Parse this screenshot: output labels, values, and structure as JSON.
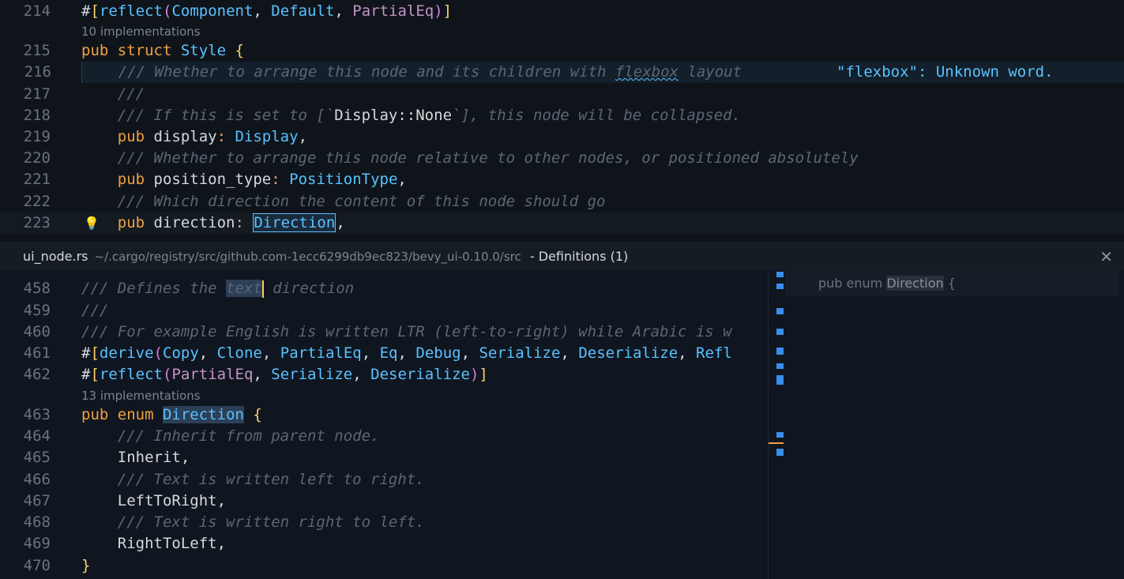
{
  "editor": {
    "lines": [
      {
        "num": "214",
        "tokens": [
          [
            "punc",
            "#"
          ],
          [
            "br1",
            "["
          ],
          [
            "fn",
            "reflect"
          ],
          [
            "br2",
            "("
          ],
          [
            "ty",
            "Component"
          ],
          [
            "punc",
            ", "
          ],
          [
            "ty",
            "Default"
          ],
          [
            "punc",
            ", "
          ],
          [
            "gen",
            "PartialEq"
          ],
          [
            "br2",
            ")"
          ],
          [
            "br1",
            "]"
          ]
        ]
      },
      {
        "num": "215",
        "tokens": [
          [
            "kw",
            "pub "
          ],
          [
            "kw",
            "struct "
          ],
          [
            "ty",
            "Style "
          ],
          [
            "br1",
            "{"
          ]
        ]
      },
      {
        "num": "216",
        "tokens": [
          [
            "cm",
            "    /// Whether to arrange this node and its children with "
          ],
          [
            "cm squiggle",
            "flexbox"
          ],
          [
            "cm",
            " layout"
          ]
        ]
      },
      {
        "num": "217",
        "tokens": [
          [
            "cm",
            "    ///"
          ]
        ]
      },
      {
        "num": "218",
        "tokens": [
          [
            "cm",
            "    /// If this is set to [`"
          ],
          [
            "punc",
            "Display::None"
          ],
          [
            "cm",
            "`], this node will be collapsed."
          ]
        ]
      },
      {
        "num": "219",
        "tokens": [
          [
            "kw",
            "    pub "
          ],
          [
            "punc",
            "display"
          ],
          [
            "op",
            ": "
          ],
          [
            "ty",
            "Display"
          ],
          [
            "punc",
            ","
          ]
        ]
      },
      {
        "num": "220",
        "tokens": [
          [
            "cm",
            "    /// Whether to arrange this node relative to other nodes, or positioned absolutely"
          ]
        ]
      },
      {
        "num": "221",
        "tokens": [
          [
            "kw",
            "    pub "
          ],
          [
            "punc",
            "position_type"
          ],
          [
            "op",
            ": "
          ],
          [
            "ty",
            "PositionType"
          ],
          [
            "punc",
            ","
          ]
        ]
      },
      {
        "num": "222",
        "tokens": [
          [
            "cm",
            "    /// Which direction the content of this node should go"
          ]
        ]
      },
      {
        "num": "223",
        "tokens": [
          [
            "kw",
            "    pub "
          ],
          [
            "punc",
            "direction"
          ],
          [
            "op",
            ": "
          ],
          [
            "ty boxed",
            "Direction"
          ],
          [
            "punc",
            ","
          ]
        ]
      }
    ],
    "lens_top": "10 implementations",
    "diagnostic": "\"flexbox\": Unknown word."
  },
  "peek": {
    "file": "ui_node.rs",
    "path": "~/.cargo/registry/src/github.com-1ecc6299db9ec823/bevy_ui-0.10.0/src",
    "title": "- Definitions (1)",
    "close_icon": "close-icon",
    "ref_prefix": "pub enum ",
    "ref_name": "Direction",
    "ref_suffix": " {",
    "lens": "13 implementations",
    "lines": [
      {
        "num": "458",
        "tokens": [
          [
            "cm",
            "/// Defines the "
          ],
          [
            "cm sel",
            "text"
          ],
          [
            "cursor",
            ""
          ],
          [
            "cm",
            " direction"
          ]
        ]
      },
      {
        "num": "459",
        "tokens": [
          [
            "cm",
            "///"
          ]
        ]
      },
      {
        "num": "460",
        "tokens": [
          [
            "cm",
            "/// For example English is written LTR (left-to-right) while Arabic is w"
          ]
        ]
      },
      {
        "num": "461",
        "tokens": [
          [
            "punc",
            "#"
          ],
          [
            "br1",
            "["
          ],
          [
            "fn",
            "derive"
          ],
          [
            "br2",
            "("
          ],
          [
            "ty",
            "Copy"
          ],
          [
            "punc",
            ", "
          ],
          [
            "ty",
            "Clone"
          ],
          [
            "punc",
            ", "
          ],
          [
            "ty",
            "PartialEq"
          ],
          [
            "punc",
            ", "
          ],
          [
            "ty",
            "Eq"
          ],
          [
            "punc",
            ", "
          ],
          [
            "ty",
            "Debug"
          ],
          [
            "punc",
            ", "
          ],
          [
            "ty",
            "Serialize"
          ],
          [
            "punc",
            ", "
          ],
          [
            "ty",
            "Deserialize"
          ],
          [
            "punc",
            ", "
          ],
          [
            "ty",
            "Refl"
          ]
        ]
      },
      {
        "num": "462",
        "tokens": [
          [
            "punc",
            "#"
          ],
          [
            "br1",
            "["
          ],
          [
            "fn",
            "reflect"
          ],
          [
            "br2",
            "("
          ],
          [
            "gen",
            "PartialEq"
          ],
          [
            "punc",
            ", "
          ],
          [
            "ty",
            "Serialize"
          ],
          [
            "punc",
            ", "
          ],
          [
            "ty",
            "Deserialize"
          ],
          [
            "br2",
            ")"
          ],
          [
            "br1",
            "]"
          ]
        ]
      },
      {
        "num": "463",
        "tokens": [
          [
            "kw",
            "pub "
          ],
          [
            "kw",
            "enum "
          ],
          [
            "ty sel",
            "Direction"
          ],
          [
            "punc",
            " "
          ],
          [
            "br1",
            "{"
          ]
        ]
      },
      {
        "num": "464",
        "tokens": [
          [
            "cm",
            "    /// Inherit from parent node."
          ]
        ]
      },
      {
        "num": "465",
        "tokens": [
          [
            "punc",
            "    Inherit,"
          ]
        ]
      },
      {
        "num": "466",
        "tokens": [
          [
            "cm",
            "    /// Text is written left to right."
          ]
        ]
      },
      {
        "num": "467",
        "tokens": [
          [
            "punc",
            "    LeftToRight,"
          ]
        ]
      },
      {
        "num": "468",
        "tokens": [
          [
            "cm",
            "    /// Text is written right to left."
          ]
        ]
      },
      {
        "num": "469",
        "tokens": [
          [
            "punc",
            "    RightToLeft,"
          ]
        ]
      },
      {
        "num": "470",
        "tokens": [
          [
            "br1",
            "}"
          ]
        ]
      }
    ]
  }
}
